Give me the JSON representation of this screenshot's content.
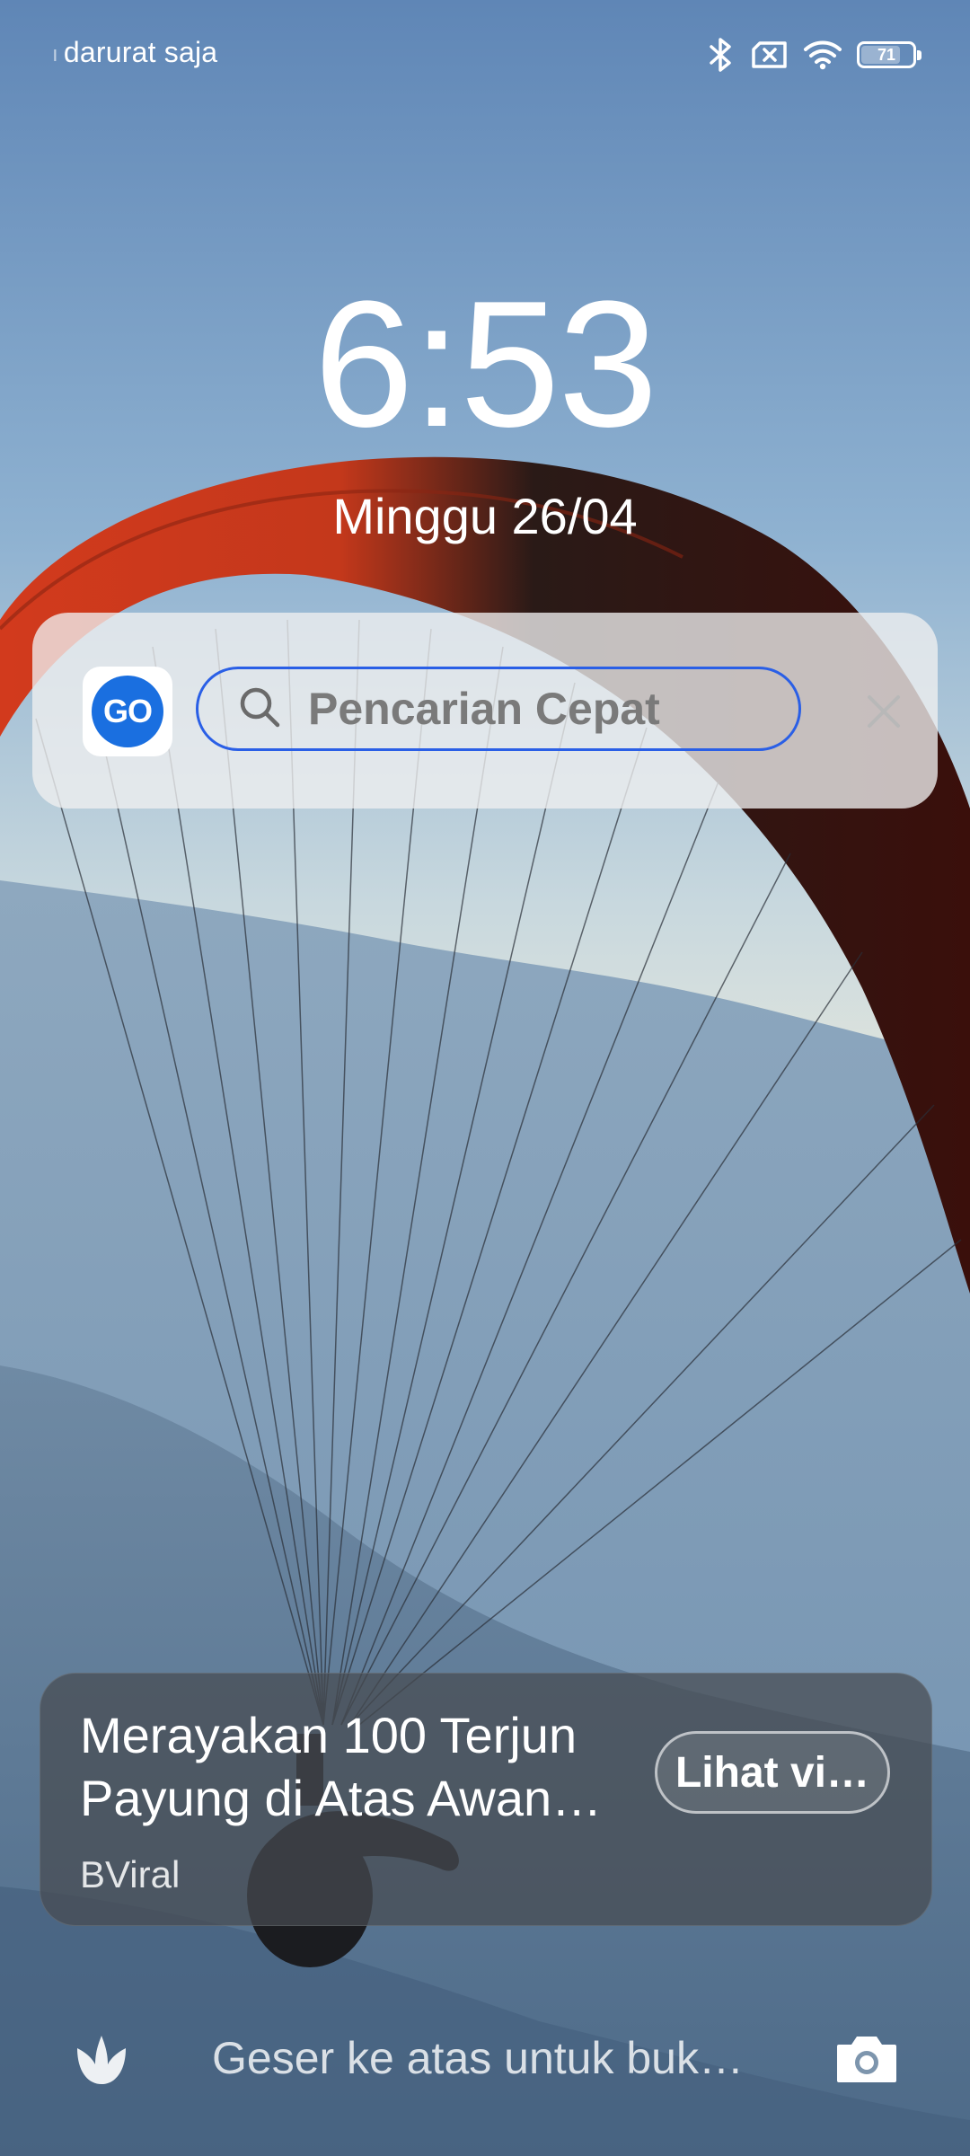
{
  "status_bar": {
    "carrier": "darurat saja",
    "battery_level": 71,
    "battery_text": "71",
    "icons": [
      "bluetooth-icon",
      "no-sim-icon",
      "wifi-icon",
      "battery-icon"
    ]
  },
  "lock_screen": {
    "time": "6:53",
    "date": "Minggu 26/04"
  },
  "search_widget": {
    "logo_text": "GO",
    "placeholder": "Pencarian Cepat",
    "accent_color": "#2a5fe6"
  },
  "news_card": {
    "title": "Merayakan 100 Terjun Payung di Atas Awan…",
    "source": "BViral",
    "action_label": "Lihat vi…"
  },
  "bottom_bar": {
    "unlock_hint": "Geser ke atas untuk buk…",
    "left_icon": "tulip-icon",
    "right_icon": "camera-icon"
  }
}
